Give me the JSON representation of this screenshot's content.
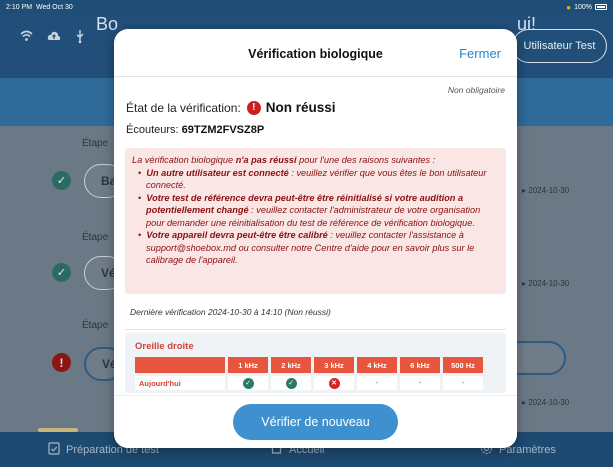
{
  "status_bar": {
    "time": "2:10 PM",
    "date": "Wed Oct 30",
    "battery": "100%"
  },
  "top_bar": {
    "user_button": "Utilisateur Test"
  },
  "hero": {
    "left_text": "Bo",
    "right_text": "ui!"
  },
  "steps": [
    {
      "label": "Étape",
      "button": "Ba",
      "date": "2024-10-30",
      "status": "ok"
    },
    {
      "label": "Étape",
      "button": "Vé",
      "date": "2024-10-30",
      "status": "ok"
    },
    {
      "label": "Étape",
      "button": "Vé",
      "date": "2024-10-30",
      "status": "error"
    }
  ],
  "bottom_nav": {
    "tabs": [
      {
        "label": "Préparation de test",
        "icon": "clipboard-icon"
      },
      {
        "label": "Accueil",
        "icon": "home-icon"
      },
      {
        "label": "Paramètres",
        "icon": "gear-icon"
      }
    ]
  },
  "modal": {
    "title": "Vérification biologique",
    "close_label": "Fermer",
    "optional_note": "Non obligatoire",
    "status_label": "État de la vérification:",
    "status_value": "Non réussi",
    "headphones_label": "Écouteurs:",
    "headphones_value": "69TZM2FVSZ8P",
    "alert": {
      "intro_pre": "La vérification biologique ",
      "intro_bold": "n'a pas réussi",
      "intro_post": " pour l'une des raisons suivantes :",
      "reason1_bold": "Un autre utilisateur est connecté",
      "reason1_text": " : veuillez vérifier que vous êtes le bon utilisateur connecté.",
      "reason2_bold": "Votre test de référence devra peut-être être réinitialisé si votre audition a potentiellement changé",
      "reason2_text": " : veuillez contacter l'administrateur de votre organisation pour demander une réinitialisation du test de référence de vérification biologique.",
      "reason3_bold": "Votre appareil devra peut-être être calibré",
      "reason3_text": " : veuillez contacter l'assistance à support@shoebox.md ou consulter notre Centre d'aide pour en savoir plus sur le calibrage de l'appareil."
    },
    "last_check": "Dernière vérification 2024-10-30 à 14:10 (Non réussi)",
    "ear_title": "Oreille droite",
    "table": {
      "headers": [
        "",
        "1 kHz",
        "2 kHz",
        "3 kHz",
        "4 kHz",
        "6 kHz",
        "500 Hz"
      ],
      "row_label": "Aujourd'hui",
      "results": [
        "ok",
        "ok",
        "fail",
        "-",
        "-",
        "-"
      ]
    },
    "retry_button": "Vérifier de nouveau"
  }
}
